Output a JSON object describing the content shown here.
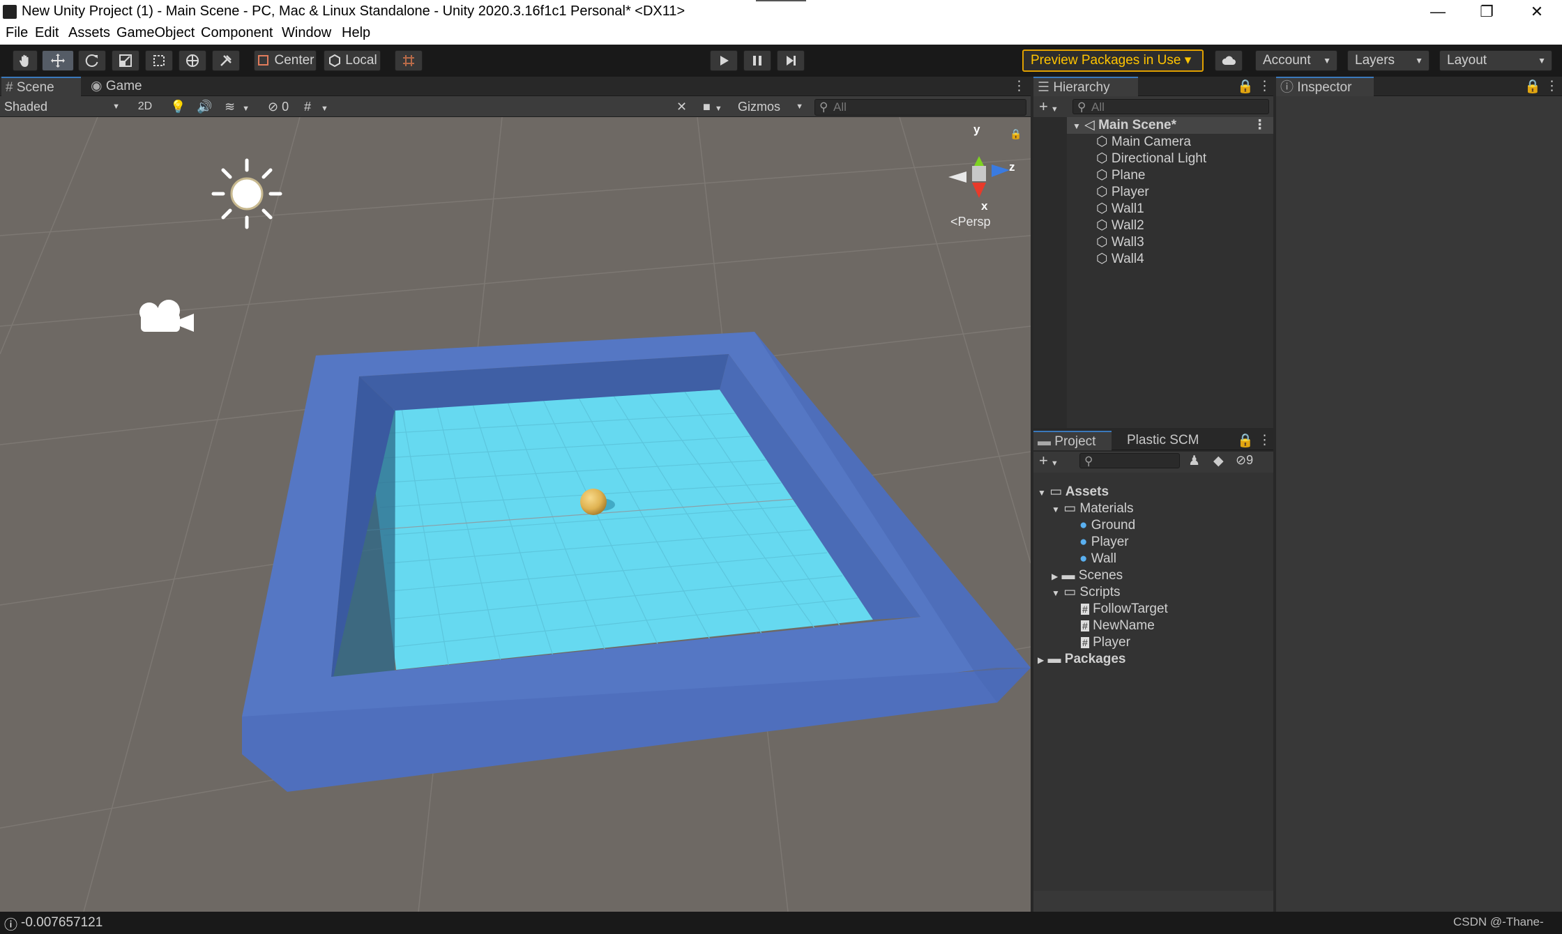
{
  "window": {
    "title": "New Unity Project (1) - Main Scene - PC, Mac & Linux Standalone - Unity 2020.3.16f1c1 Personal* <DX11>",
    "controls": {
      "minimize": "—",
      "restore": "❐",
      "close": "✕"
    }
  },
  "menu": [
    "File",
    "Edit",
    "Assets",
    "GameObject",
    "Component",
    "Window",
    "Help"
  ],
  "toolbar": {
    "pivot_label": "Center",
    "space_label": "Local",
    "preview_packages": "Preview Packages in Use ▾",
    "account": "Account",
    "layers": "Layers",
    "layout": "Layout"
  },
  "scene_tabs": {
    "scene": "Scene",
    "game": "Game"
  },
  "scene_toolbar": {
    "shading_mode": "Shaded",
    "mode_2d": "2D",
    "hidden_count": "0",
    "gizmos": "Gizmos",
    "search_placeholder": "All"
  },
  "gizmo": {
    "y": "y",
    "z": "z",
    "x": "x",
    "persp": "<Persp"
  },
  "hierarchy": {
    "tab": "Hierarchy",
    "search_placeholder": "All",
    "scene_name": "Main Scene*",
    "objects": [
      "Main Camera",
      "Directional Light",
      "Plane",
      "Player",
      "Wall1",
      "Wall2",
      "Wall3",
      "Wall4"
    ]
  },
  "inspector": {
    "tab": "Inspector"
  },
  "project": {
    "tab": "Project",
    "tab2": "Plastic SCM",
    "hidden_count": "9",
    "tree": {
      "assets": "Assets",
      "materials": "Materials",
      "materials_items": [
        "Ground",
        "Player",
        "Wall"
      ],
      "scenes": "Scenes",
      "scripts": "Scripts",
      "scripts_items": [
        "FollowTarget",
        "NewName",
        "Player"
      ],
      "packages": "Packages"
    }
  },
  "status": {
    "message": "-0.007657121",
    "watermark": "CSDN @-Thane-"
  },
  "colors": {
    "accent": "#3a79bb",
    "ground": "#66d9f0",
    "wall": "#5577c4",
    "player": "#e0b858",
    "scene_bg": "#6e6964",
    "preview_packages": "#ffc400"
  }
}
